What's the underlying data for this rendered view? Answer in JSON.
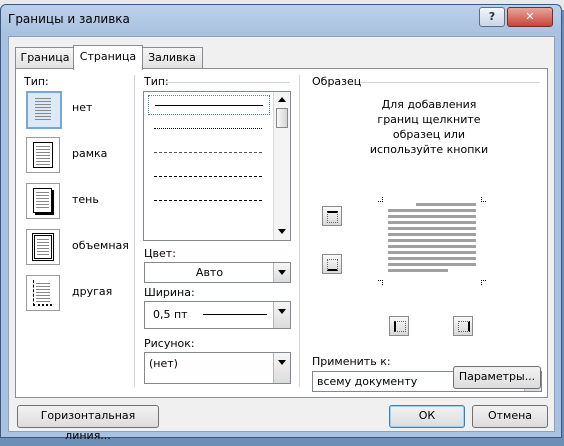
{
  "window": {
    "title": "Границы и заливка"
  },
  "tabs": [
    {
      "label": "Граница"
    },
    {
      "label": "Страница"
    },
    {
      "label": "Заливка"
    }
  ],
  "settings": {
    "label": "Тип:",
    "items": [
      {
        "label": "нет"
      },
      {
        "label": "рамка"
      },
      {
        "label": "тень"
      },
      {
        "label": "объемная"
      },
      {
        "label": "другая"
      }
    ]
  },
  "style": {
    "label": "Тип:",
    "color_label": "Цвет:",
    "color_value": "Авто",
    "width_label": "Ширина:",
    "width_value": "0,5 пт",
    "art_label": "Рисунок:",
    "art_value": "(нет)"
  },
  "preview": {
    "label": "Образец",
    "hint": "Для добавления границ щелкните образец или используйте кнопки",
    "apply_label": "Применить к:",
    "apply_value": "всему документу",
    "params_button": "Параметры..."
  },
  "footer": {
    "horizontal_line": "Горизонтальная линия...",
    "ok": "ОК",
    "cancel": "Отмена"
  },
  "colors": {
    "accent": "#7aa6d6",
    "title_bar": "#a9c2e0"
  }
}
